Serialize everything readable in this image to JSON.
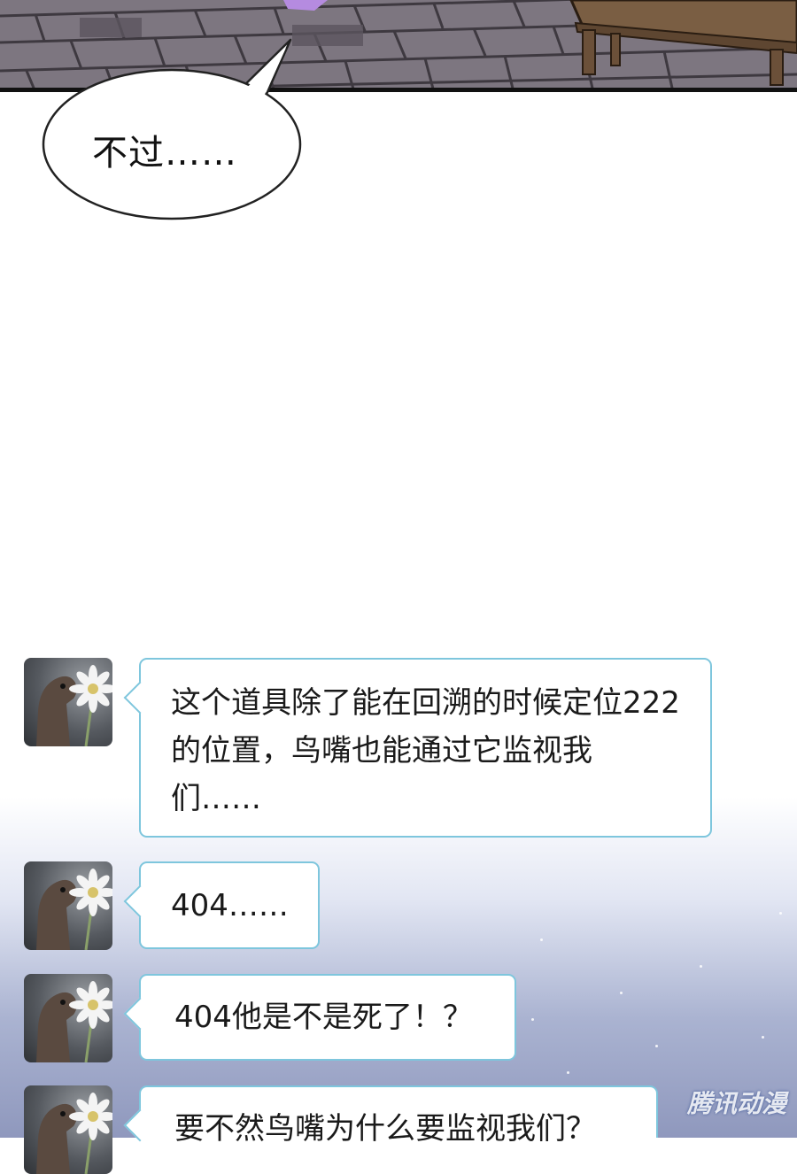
{
  "speech": {
    "text": "不过……"
  },
  "messages": [
    {
      "text": "这个道具除了能在回溯的时候定位222的位置，鸟嘴也能通过它监视我们……"
    },
    {
      "text": "404……"
    },
    {
      "text": "404他是不是死了！？"
    },
    {
      "text": "要不然鸟嘴为什么要监视我们？"
    }
  ],
  "watermark": {
    "text": "腾讯动漫"
  },
  "colors": {
    "bubble_border": "#7ec6dd",
    "pavement": "#7e7782"
  }
}
